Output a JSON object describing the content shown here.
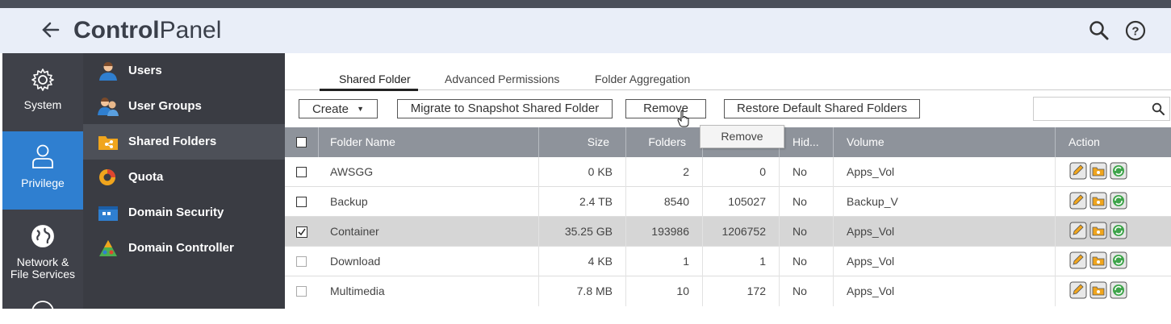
{
  "header": {
    "title_bold": "Control",
    "title_light": "Panel"
  },
  "categories": [
    {
      "label": "System",
      "icon": "gear-icon"
    },
    {
      "label": "Privilege",
      "icon": "user-icon",
      "active": true
    },
    {
      "label": "Network &",
      "label2": "File Services",
      "icon": "globe-icon"
    }
  ],
  "subnav": [
    {
      "label": "Users",
      "icon": "users-icon"
    },
    {
      "label": "User Groups",
      "icon": "user-groups-icon"
    },
    {
      "label": "Shared Folders",
      "icon": "shared-folders-icon",
      "active": true
    },
    {
      "label": "Quota",
      "icon": "quota-icon"
    },
    {
      "label": "Domain Security",
      "icon": "domain-security-icon"
    },
    {
      "label": "Domain Controller",
      "icon": "domain-controller-icon"
    }
  ],
  "tabs": [
    "Shared Folder",
    "Advanced Permissions",
    "Folder Aggregation"
  ],
  "toolbar": {
    "create": "Create",
    "migrate": "Migrate to Snapshot Shared Folder",
    "remove": "Remove",
    "restore": "Restore Default Shared Folders",
    "search_placeholder": ""
  },
  "tooltip": "Remove",
  "table": {
    "headers": {
      "folder_name": "Folder Name",
      "size": "Size",
      "folders": "Folders",
      "files": "",
      "hidden": "Hid...",
      "volume": "Volume",
      "action": "Action"
    },
    "rows": [
      {
        "name": "AWSGG",
        "size": "0 KB",
        "folders": "2",
        "files": "0",
        "hidden": "No",
        "volume": "Apps_Vol",
        "checked": false
      },
      {
        "name": "Backup",
        "size": "2.4 TB",
        "folders": "8540",
        "files": "105027",
        "hidden": "No",
        "volume": "Backup_V",
        "checked": false
      },
      {
        "name": "Container",
        "size": "35.25 GB",
        "folders": "193986",
        "files": "1206752",
        "hidden": "No",
        "volume": "Apps_Vol",
        "checked": true
      },
      {
        "name": "Download",
        "size": "4 KB",
        "folders": "1",
        "files": "1",
        "hidden": "No",
        "volume": "Apps_Vol",
        "checked": false
      },
      {
        "name": "Multimedia",
        "size": "7.8 MB",
        "folders": "10",
        "files": "172",
        "hidden": "No",
        "volume": "Apps_Vol",
        "checked": false
      }
    ]
  },
  "colors": {
    "accent": "#2f7fd0",
    "sidebar": "#3f4149",
    "header_bg": "#e9eef8"
  }
}
